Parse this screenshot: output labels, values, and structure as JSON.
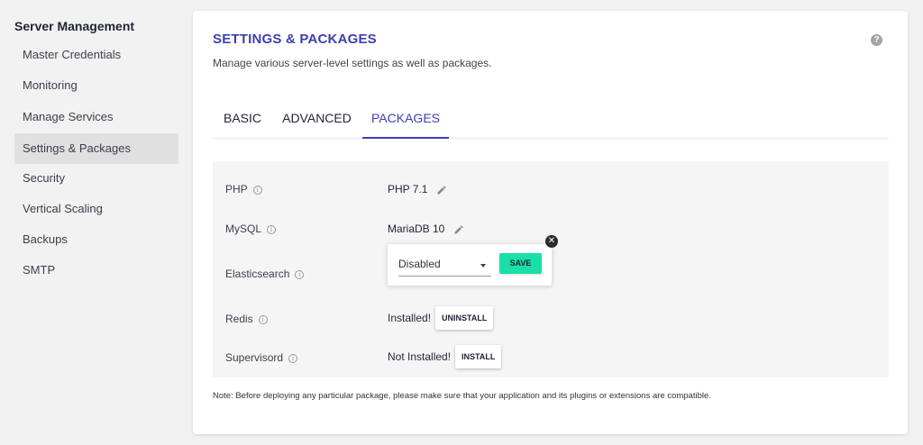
{
  "sidebar": {
    "title": "Server Management",
    "items": [
      {
        "label": "Master Credentials"
      },
      {
        "label": "Monitoring"
      },
      {
        "label": "Manage Services"
      },
      {
        "label": "Settings & Packages"
      },
      {
        "label": "Security"
      },
      {
        "label": "Vertical Scaling"
      },
      {
        "label": "Backups"
      },
      {
        "label": "SMTP"
      }
    ],
    "active_item": "Settings & Packages"
  },
  "main": {
    "title": "SETTINGS & PACKAGES",
    "subtitle": "Manage various server-level settings as well as packages.",
    "help_glyph": "?",
    "tabs": [
      {
        "label": "BASIC"
      },
      {
        "label": "ADVANCED"
      },
      {
        "label": "PACKAGES"
      }
    ],
    "active_tab": "PACKAGES",
    "packages": {
      "php": {
        "label": "PHP",
        "value": "PHP 7.1"
      },
      "mysql": {
        "label": "MySQL",
        "value": "MariaDB 10"
      },
      "elasticsearch": {
        "label": "Elasticsearch",
        "selected": "Disabled",
        "save_label": "SAVE"
      },
      "redis": {
        "label": "Redis",
        "status": "Installed!",
        "action_label": "UNINSTALL"
      },
      "supervisord": {
        "label": "Supervisord",
        "status": "Not Installed!",
        "action_label": "INSTALL"
      }
    },
    "info_glyph": "i",
    "close_glyph": "✕",
    "note": "Note: Before deploying any particular package, please make sure that your application and its plugins or extensions are compatible."
  },
  "colors": {
    "accent": "#3d3fb0",
    "save_button": "#18e0a6",
    "background": "#f2f2f2",
    "active_sidebar": "#e0e0e0"
  },
  "icons": [
    "help-icon",
    "info-icon",
    "pencil-icon",
    "close-icon",
    "chevron-down-icon"
  ]
}
